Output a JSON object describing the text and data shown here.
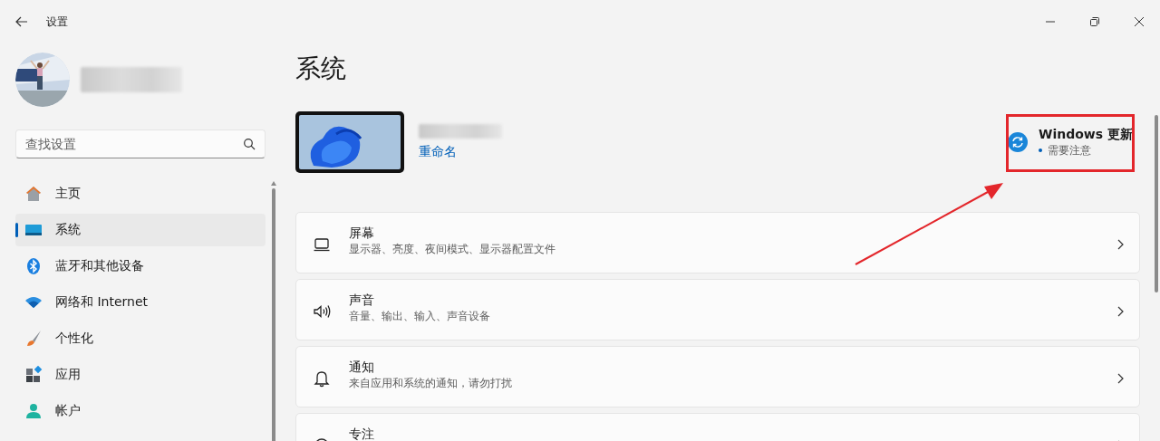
{
  "window": {
    "title": "设置"
  },
  "search": {
    "placeholder": "查找设置"
  },
  "nav": [
    {
      "label": "主页",
      "selected": false
    },
    {
      "label": "系统",
      "selected": true
    },
    {
      "label": "蓝牙和其他设备",
      "selected": false
    },
    {
      "label": "网络和 Internet",
      "selected": false
    },
    {
      "label": "个性化",
      "selected": false
    },
    {
      "label": "应用",
      "selected": false
    },
    {
      "label": "帐户",
      "selected": false
    }
  ],
  "page_title": "系统",
  "device": {
    "action": "重命名"
  },
  "update": {
    "title": "Windows 更新",
    "status": "需要注意"
  },
  "settings": [
    {
      "title": "屏幕",
      "description": "显示器、亮度、夜间模式、显示器配置文件"
    },
    {
      "title": "声音",
      "description": "音量、输出、输入、声音设备"
    },
    {
      "title": "通知",
      "description": "来自应用和系统的通知，请勿打扰"
    },
    {
      "title": "专注"
    }
  ]
}
